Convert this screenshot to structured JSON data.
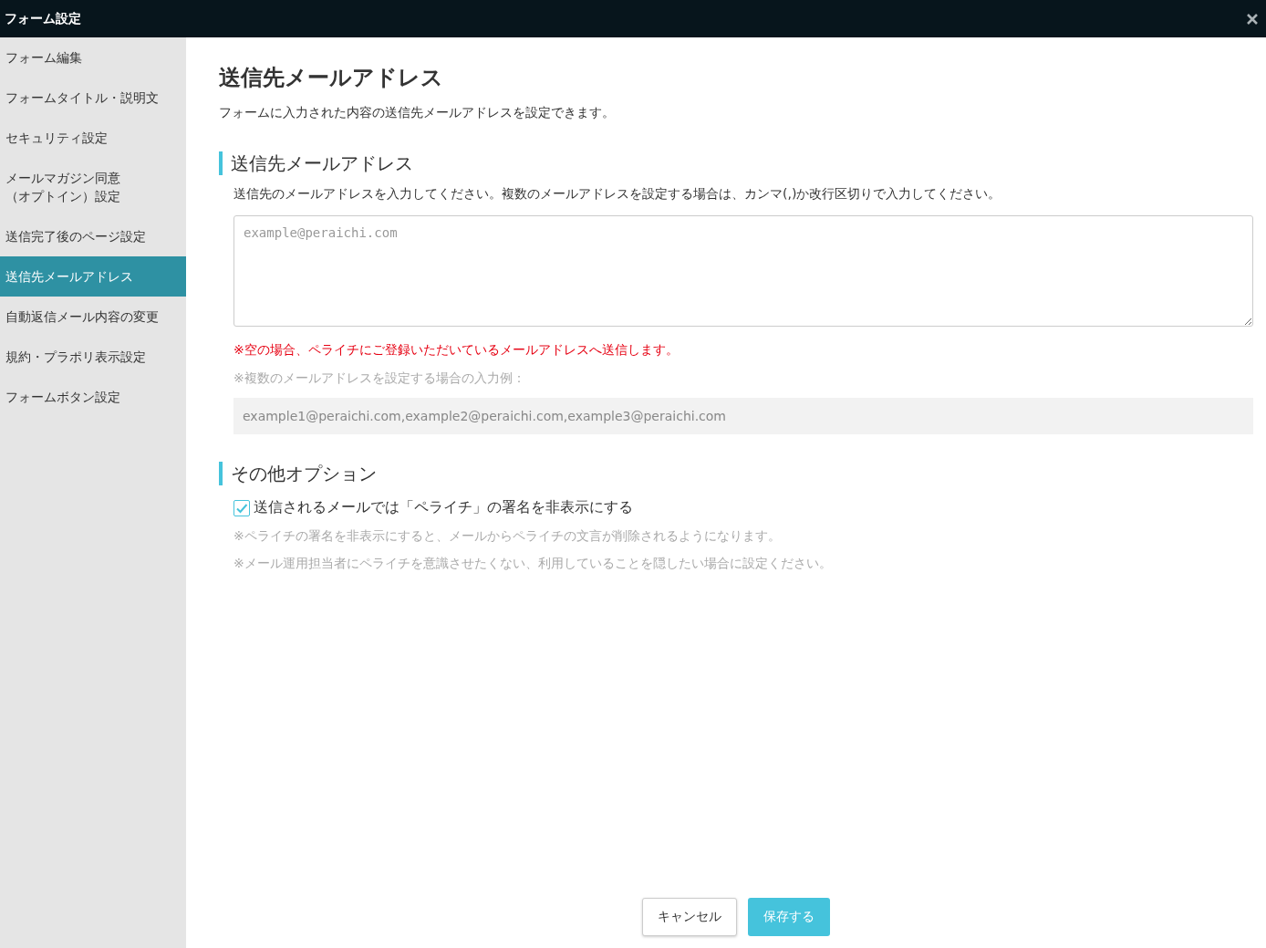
{
  "header": {
    "title": "フォーム設定"
  },
  "sidebar": {
    "items": [
      {
        "lines": [
          "フォーム編集"
        ],
        "selected": false
      },
      {
        "lines": [
          "フォームタイトル・説明文"
        ],
        "selected": false
      },
      {
        "lines": [
          "セキュリティ設定"
        ],
        "selected": false
      },
      {
        "lines": [
          "メールマガジン同意",
          "（オプトイン）設定"
        ],
        "selected": false
      },
      {
        "lines": [
          "送信完了後のページ設定"
        ],
        "selected": false
      },
      {
        "lines": [
          "送信先メールアドレス"
        ],
        "selected": true
      },
      {
        "lines": [
          "自動返信メール内容の変更"
        ],
        "selected": false
      },
      {
        "lines": [
          "規約・プラポリ表示設定"
        ],
        "selected": false
      },
      {
        "lines": [
          "フォームボタン設定"
        ],
        "selected": false
      }
    ]
  },
  "page": {
    "title": "送信先メールアドレス",
    "description": "フォームに入力された内容の送信先メールアドレスを設定できます。"
  },
  "address_section": {
    "heading": "送信先メールアドレス",
    "instruction": "送信先のメールアドレスを入力してください。複数のメールアドレスを設定する場合は、カンマ(,)か改行区切りで入力してください。",
    "placeholder": "example@peraichi.com",
    "warning": "※空の場合、ペライチにご登録いただいているメールアドレスへ送信します。",
    "example_label": "※複数のメールアドレスを設定する場合の入力例：",
    "example": "example1@peraichi.com,example2@peraichi.com,example3@peraichi.com"
  },
  "options_section": {
    "heading": "その他オプション",
    "checkbox": {
      "label": "送信されるメールでは「ペライチ」の署名を非表示にする",
      "checked": true
    },
    "notes": [
      "※ペライチの署名を非表示にすると、メールからペライチの文言が削除されるようになります。",
      "※メール運用担当者にペライチを意識させたくない、利用していることを隠したい場合に設定ください。"
    ]
  },
  "buttons": {
    "cancel": "キャンセル",
    "save": "保存する"
  }
}
